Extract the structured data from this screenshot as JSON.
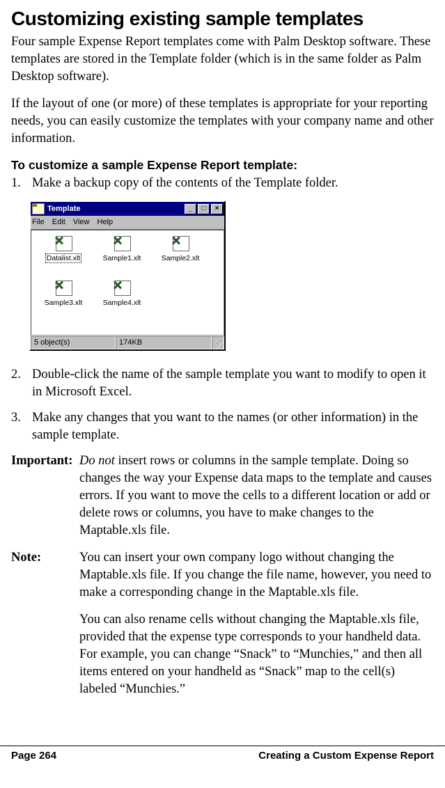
{
  "title": "Customizing existing sample templates",
  "para1": "Four sample Expense Report templates come with Palm Desktop software. These templates are stored in the Template folder (which is in the same folder as Palm Desktop software).",
  "para2": "If the layout of one (or more) of these templates is appropriate for your reporting needs, you can easily customize the templates with your company name and other information.",
  "subhead": "To customize a sample Expense Report template:",
  "steps": {
    "s1": "Make a backup copy of the contents of the Template folder.",
    "s2": "Double-click the name of the sample template you want to modify to open it in Microsoft Excel.",
    "s3": "Make any changes that you want to the names (or other information) in the sample template."
  },
  "win": {
    "title": "Template",
    "menus": {
      "m1": "File",
      "m2": "Edit",
      "m3": "View",
      "m4": "Help"
    },
    "btns": {
      "min": "_",
      "max": "□",
      "close": "×"
    },
    "files": {
      "f1": "Datalist.xlt",
      "f2": "Sample1.xlt",
      "f3": "Sample2.xlt",
      "f4": "Sample3.xlt",
      "f5": "Sample4.xlt"
    },
    "status": {
      "objects": "5 object(s)",
      "size": "174KB"
    }
  },
  "important": {
    "label": "Important:",
    "italic": "Do not",
    "rest": " insert rows or columns in the sample template. Doing so changes the way your Expense data maps to the template and causes errors. If you want to move the cells to a different location or add or delete rows or columns, you have to make changes to the Maptable.xls file."
  },
  "note": {
    "label": "Note:",
    "p1": "You can insert your own company logo without changing the Maptable.xls file. If you change the file name, however, you need to make a corresponding change in the Maptable.xls file.",
    "p2": "You can also rename cells without changing the Maptable.xls file, provided that the expense type corresponds to your handheld data. For example, you can change “Snack” to “Munchies,” and then all items entered on your handheld as “Snack” map to the cell(s) labeled “Munchies.”"
  },
  "footer": {
    "left": "Page 264",
    "right": "Creating a Custom Expense Report"
  }
}
